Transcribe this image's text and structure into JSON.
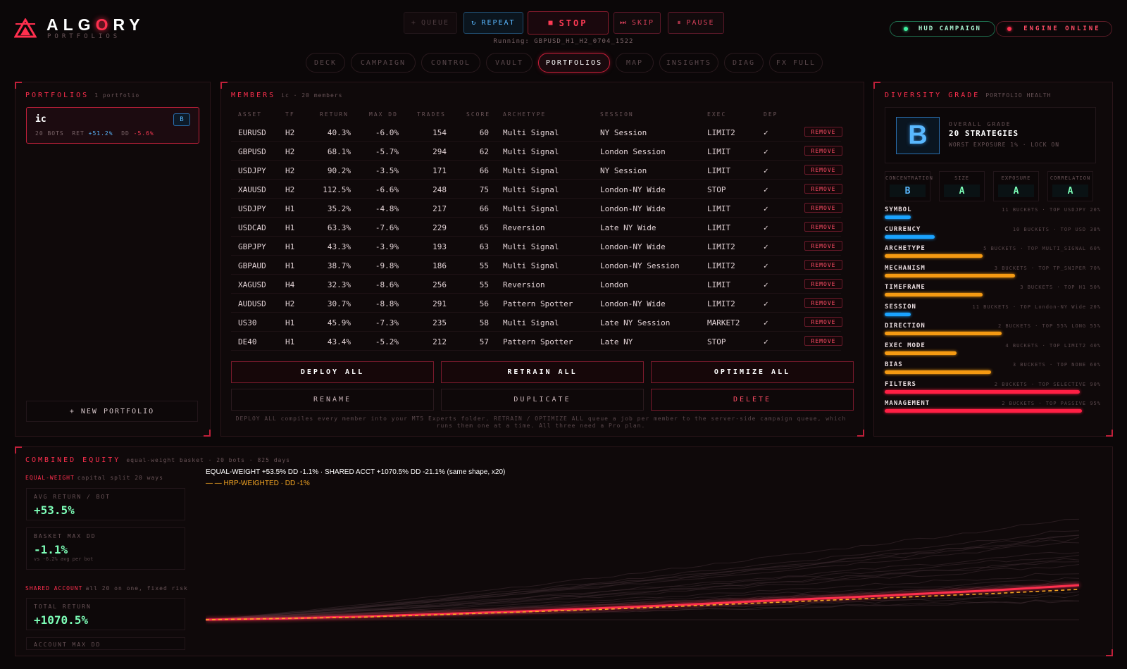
{
  "brand": {
    "title_pre": "ALG",
    "title_o": "O",
    "title_post": "RY",
    "subtitle": "PORTFOLIOS",
    "accent": "#ff2f4e"
  },
  "controls": {
    "queue": "QUEUE",
    "repeat": "REPEAT",
    "stop": "STOP",
    "skip": "SKIP",
    "pause": "PAUSE"
  },
  "running": "Running: GBPUSD_H1_H2_0704_1522",
  "status": {
    "hud": "HUD CAMPAIGN",
    "engine": "ENGINE ONLINE"
  },
  "tabs": [
    "DECK",
    "CAMPAIGN",
    "CONTROL",
    "VAULT",
    "PORTFOLIOS",
    "MAP",
    "INSIGHTS",
    "DIAG",
    "FX FULL"
  ],
  "portfolios": {
    "title": "PORTFOLIOS",
    "count": "1 portfolio",
    "card": {
      "name": "ic",
      "badge": "B",
      "bots": "20 BOTS",
      "ret_label": "RET",
      "ret": "+51.2%",
      "dd_label": "DD",
      "dd": "-5.6%"
    },
    "new_button": "+ NEW PORTFOLIO"
  },
  "members": {
    "title": "MEMBERS",
    "sub": "ic · 20 members",
    "columns": [
      "ASSET",
      "TF",
      "RETURN",
      "MAX DD",
      "TRADES",
      "SCORE",
      "ARCHETYPE",
      "SESSION",
      "EXEC",
      "DEP"
    ],
    "rows": [
      [
        "EURUSD",
        "H2",
        "40.3%",
        "-6.0%",
        "154",
        "60",
        "Multi Signal",
        "NY Session",
        "LIMIT2",
        "✓"
      ],
      [
        "GBPUSD",
        "H2",
        "68.1%",
        "-5.7%",
        "294",
        "62",
        "Multi Signal",
        "London Session",
        "LIMIT",
        "✓"
      ],
      [
        "USDJPY",
        "H2",
        "90.2%",
        "-3.5%",
        "171",
        "66",
        "Multi Signal",
        "NY Session",
        "LIMIT",
        "✓"
      ],
      [
        "XAUUSD",
        "H2",
        "112.5%",
        "-6.6%",
        "248",
        "75",
        "Multi Signal",
        "London-NY Wide",
        "STOP",
        "✓"
      ],
      [
        "USDJPY",
        "H1",
        "35.2%",
        "-4.8%",
        "217",
        "66",
        "Multi Signal",
        "London-NY Wide",
        "LIMIT",
        "✓"
      ],
      [
        "USDCAD",
        "H1",
        "63.3%",
        "-7.6%",
        "229",
        "65",
        "Reversion",
        "Late NY Wide",
        "LIMIT",
        "✓"
      ],
      [
        "GBPJPY",
        "H1",
        "43.3%",
        "-3.9%",
        "193",
        "63",
        "Multi Signal",
        "London-NY Wide",
        "LIMIT2",
        "✓"
      ],
      [
        "GBPAUD",
        "H1",
        "38.7%",
        "-9.8%",
        "186",
        "55",
        "Multi Signal",
        "London-NY Session",
        "LIMIT2",
        "✓"
      ],
      [
        "XAGUSD",
        "H4",
        "32.3%",
        "-8.6%",
        "256",
        "55",
        "Reversion",
        "London",
        "LIMIT",
        "✓"
      ],
      [
        "AUDUSD",
        "H2",
        "30.7%",
        "-8.8%",
        "291",
        "56",
        "Pattern Spotter",
        "London-NY Wide",
        "LIMIT2",
        "✓"
      ],
      [
        "US30",
        "H1",
        "45.9%",
        "-7.3%",
        "235",
        "58",
        "Multi Signal",
        "Late NY Session",
        "MARKET2",
        "✓"
      ],
      [
        "DE40",
        "H1",
        "43.4%",
        "-5.2%",
        "212",
        "57",
        "Pattern Spotter",
        "Late NY",
        "STOP",
        "✓"
      ]
    ],
    "remove_label": "REMOVE",
    "buttons": {
      "deploy": "DEPLOY ALL",
      "retrain": "RETRAIN ALL",
      "optimize": "OPTIMIZE ALL",
      "rename": "RENAME",
      "duplicate": "DUPLICATE",
      "delete": "DELETE"
    },
    "footnote": "DEPLOY ALL compiles every member into your MT5 Experts folder. RETRAIN / OPTIMIZE ALL queue a job per member to the server-side campaign queue, which runs them one at a time. All three need a Pro plan."
  },
  "diversity": {
    "title": "DIVERSITY GRADE",
    "sub": "PORTFOLIO HEALTH",
    "grade": "B",
    "grade_label": "OVERALL GRADE",
    "strategies": "20 STRATEGIES",
    "detail": "WORST EXPOSURE 1% · LOCK ON",
    "subgrades": [
      {
        "label": "CONCENTRATION",
        "value": "B",
        "color": "#59b8ff"
      },
      {
        "label": "SIZE",
        "value": "A",
        "color": "#7dffb8"
      },
      {
        "label": "EXPOSURE",
        "value": "A",
        "color": "#7dffb8"
      },
      {
        "label": "CORRELATION",
        "value": "A",
        "color": "#7dffb8"
      }
    ],
    "dimensions": [
      {
        "label": "SYMBOL",
        "info": "11 BUCKETS · TOP USDJPY 20%",
        "level": 0.12,
        "color": "#1aa3ff"
      },
      {
        "label": "CURRENCY",
        "info": "10 BUCKETS · TOP USD 38%",
        "level": 0.23,
        "color": "#1aa3ff"
      },
      {
        "label": "ARCHETYPE",
        "info": "5 BUCKETS · TOP MULTI_SIGNAL 60%",
        "level": 0.45,
        "color": "#f59a12"
      },
      {
        "label": "MECHANISM",
        "info": "3 BUCKETS · TOP TP_SNIPER 70%",
        "level": 0.6,
        "color": "#f59a12"
      },
      {
        "label": "TIMEFRAME",
        "info": "3 BUCKETS · TOP H1 50%",
        "level": 0.45,
        "color": "#f59a12"
      },
      {
        "label": "SESSION",
        "info": "11 BUCKETS · TOP London-NY Wide 20%",
        "level": 0.12,
        "color": "#1aa3ff"
      },
      {
        "label": "DIRECTION",
        "info": "2 BUCKETS · TOP 55% LONG 55%",
        "level": 0.54,
        "color": "#f59a12"
      },
      {
        "label": "EXEC MODE",
        "info": "4 BUCKETS · TOP LIMIT2 40%",
        "level": 0.33,
        "color": "#f59a12"
      },
      {
        "label": "BIAS",
        "info": "3 BUCKETS · TOP NONE 60%",
        "level": 0.49,
        "color": "#f59a12"
      },
      {
        "label": "FILTERS",
        "info": "2 BUCKETS · TOP SELECTIVE 90%",
        "level": 0.9,
        "color": "#ff1f44"
      },
      {
        "label": "MANAGEMENT",
        "info": "2 BUCKETS · TOP PASSIVE 95%",
        "level": 0.91,
        "color": "#ff1f44"
      }
    ]
  },
  "equity": {
    "title": "COMBINED EQUITY",
    "sub": "equal-weight basket · 20 bots · 825 days",
    "ew_label": "EQUAL-WEIGHT",
    "ew_sub": "capital split 20 ways",
    "avg_return_label": "AVG RETURN / BOT",
    "avg_return": "+53.5%",
    "basket_dd_label": "BASKET MAX DD",
    "basket_dd": "-1.1%",
    "basket_dd_sub": "vs -6.2% avg per bot",
    "shared_label": "SHARED ACCOUNT",
    "shared_sub": "all 20 on one, fixed risk",
    "total_return_label": "TOTAL RETURN",
    "total_return": "+1070.5%",
    "account_dd_label": "ACCOUNT MAX DD",
    "legend1": "EQUAL-WEIGHT +53.5% DD -1.1%  ·  SHARED ACCT +1070.5% DD -21.1% (same shape, x20)",
    "legend2": "— — HRP-WEIGHTED · DD -1%"
  },
  "chart_data": {
    "type": "line",
    "x": [
      0,
      75,
      150,
      225,
      300,
      375,
      450,
      525,
      600,
      675,
      750,
      825
    ],
    "series": [
      {
        "name": "EQUAL-WEIGHT",
        "values": [
          0,
          2,
          5,
          9,
          13,
          18,
          23,
          29,
          34,
          40,
          46,
          53.5
        ],
        "color": "#ff2f4e"
      },
      {
        "name": "HRP-WEIGHTED",
        "values": [
          0,
          2,
          4,
          8,
          12,
          16,
          21,
          26,
          31,
          36,
          41,
          47
        ],
        "color": "#f5a623"
      }
    ],
    "ylim": [
      0,
      180
    ]
  }
}
